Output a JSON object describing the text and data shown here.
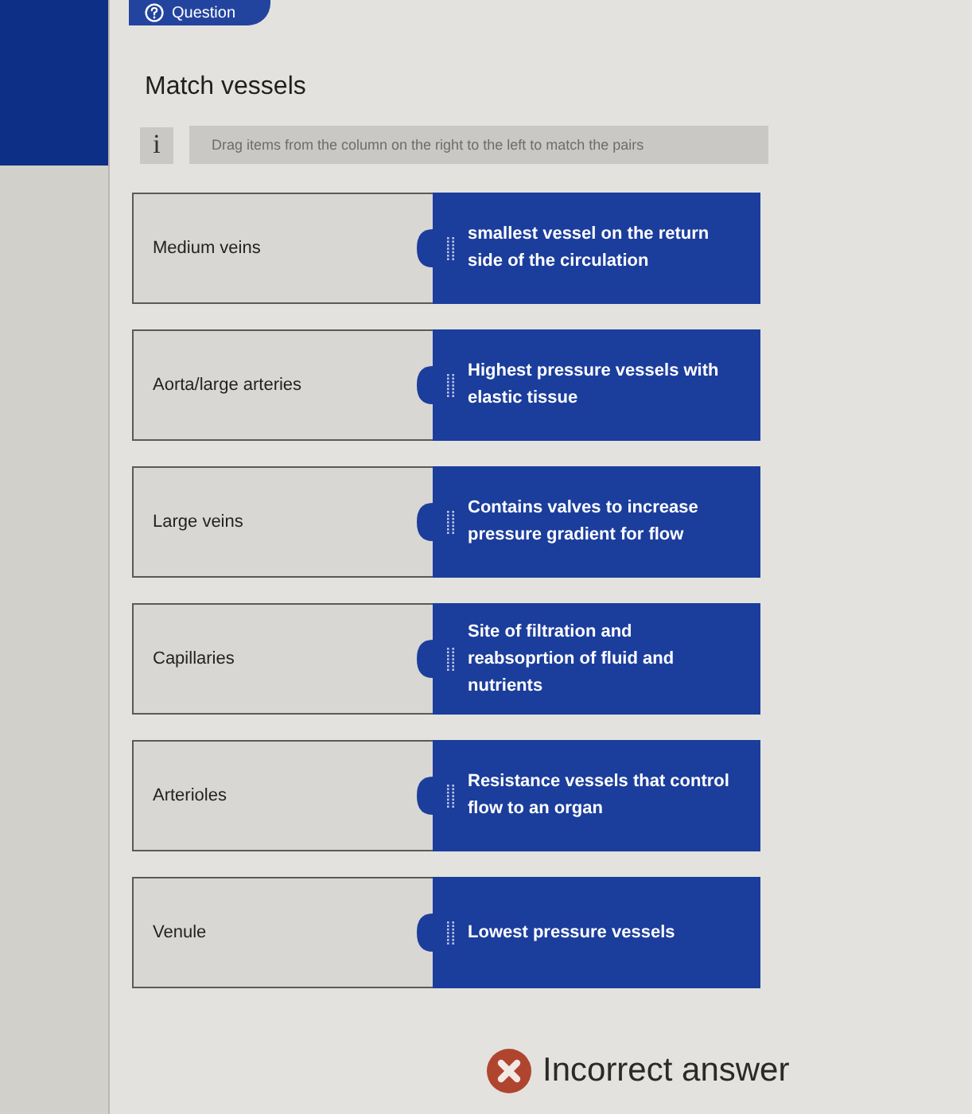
{
  "tab": {
    "label": "Question"
  },
  "title": "Match vessels",
  "info": {
    "icon": "i",
    "text": "Drag items from the column on the right to the left to match the pairs"
  },
  "pairs": [
    {
      "term": "Medium veins",
      "answer": "smallest vessel on the return side of the circulation"
    },
    {
      "term": "Aorta/large arteries",
      "answer": "Highest pressure vessels with elastic tissue"
    },
    {
      "term": "Large veins",
      "answer": "Contains valves to increase pressure gradient for flow"
    },
    {
      "term": "Capillaries",
      "answer": "Site of filtration and reabsoprtion of fluid and nutrients"
    },
    {
      "term": "Arterioles",
      "answer": "Resistance vessels that control flow to an organ"
    },
    {
      "term": "Venule",
      "answer": "Lowest pressure vessels"
    }
  ],
  "result": {
    "correct": false,
    "text": "Incorrect answer"
  }
}
